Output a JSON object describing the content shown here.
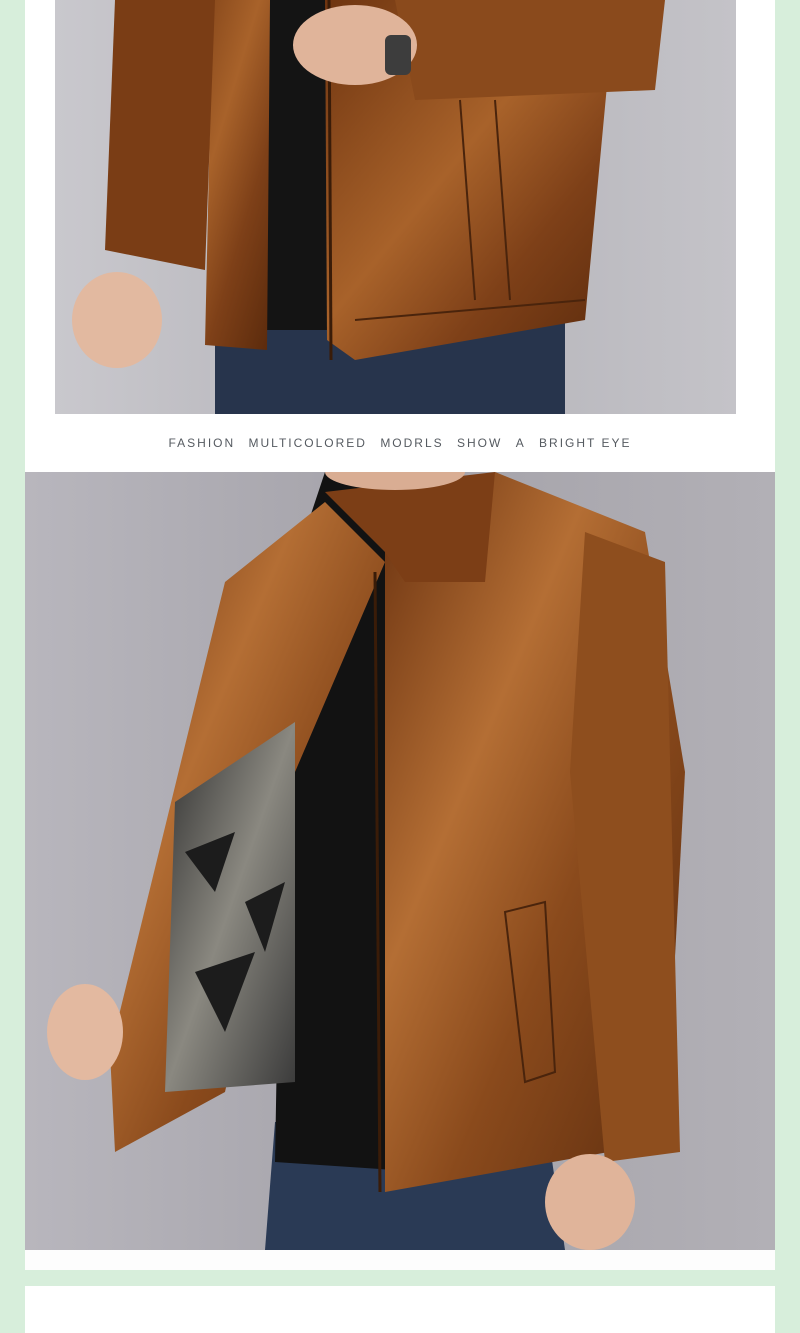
{
  "caption": {
    "words": [
      "FASHION",
      "MULTICOLORED",
      "MODRLS",
      "SHOW",
      "A",
      "BRIGHT EYE"
    ]
  },
  "colors": {
    "page_background": "#d7eedb",
    "card_background": "#ffffff",
    "leather_brown": "#8a4a1c",
    "leather_highlight": "#c07a3a",
    "sweater_black": "#121212",
    "denim_blue": "#2a3a55",
    "backdrop_gray": "#b9b9bf"
  },
  "images": {
    "top": "leather-jacket-detail-photo",
    "main": "leather-jacket-model-photo"
  }
}
